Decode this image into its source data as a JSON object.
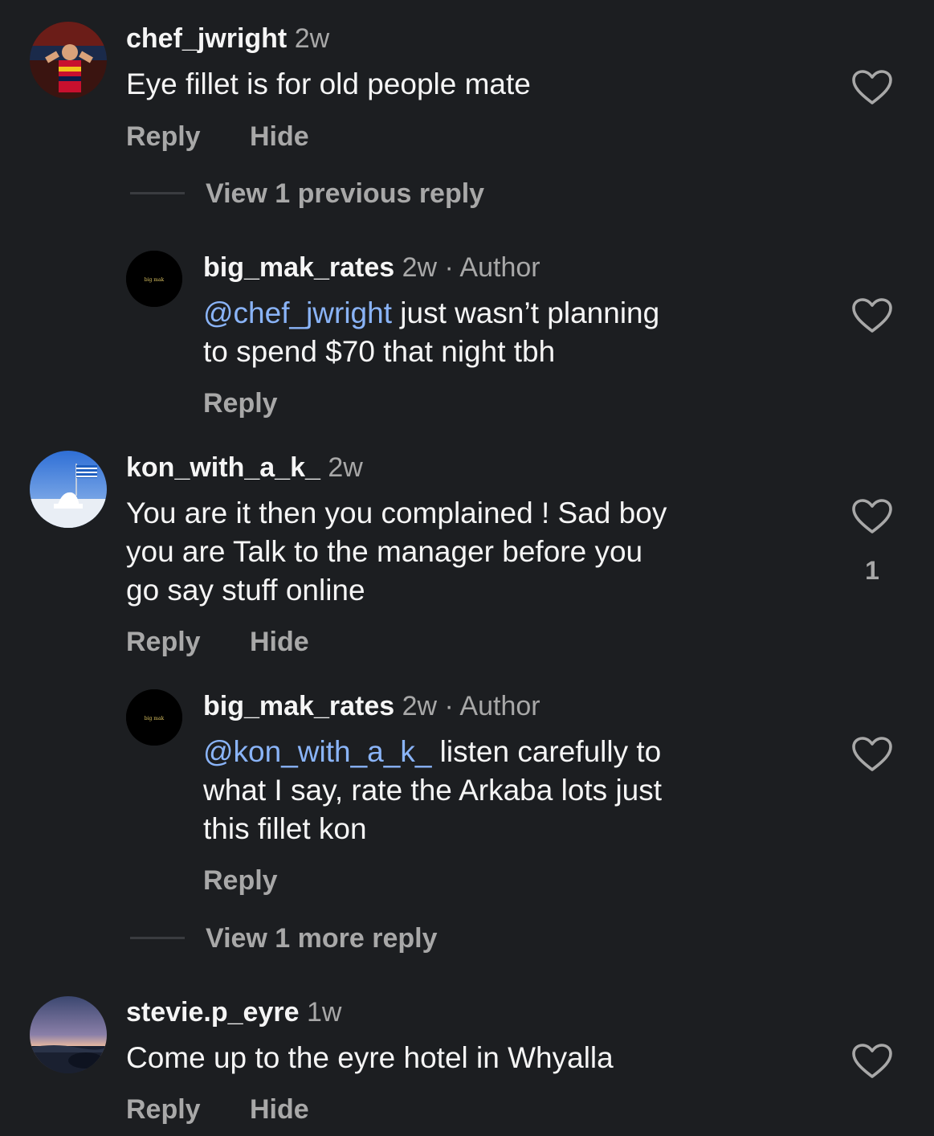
{
  "comments": [
    {
      "username": "chef_jwright",
      "time": "2w",
      "text": "Eye fillet is for old people mate",
      "reply_label": "Reply",
      "hide_label": "Hide"
    },
    {
      "username": "kon_with_a_k_",
      "time": "2w",
      "text_lines": [
        "You are it then you complained ! Sad boy",
        "you are Talk to the manager before you",
        "go say stuff online"
      ],
      "like_count": "1",
      "reply_label": "Reply",
      "hide_label": "Hide"
    },
    {
      "username": "stevie.p_eyre",
      "time": "1w",
      "text": "Come up to the eyre hotel in Whyalla",
      "reply_label": "Reply",
      "hide_label": "Hide"
    }
  ],
  "replies": [
    {
      "username": "big_mak_rates",
      "time": "2w",
      "separator": "·",
      "badge": "Author",
      "mention": "@chef_jwright",
      "line1_rest": " just wasn’t planning",
      "line2": "to spend $70 that night tbh",
      "reply_label": "Reply",
      "avatar_text": "big mak"
    },
    {
      "username": "big_mak_rates",
      "time": "2w",
      "separator": "·",
      "badge": "Author",
      "mention": "@kon_with_a_k_",
      "line1_rest": " listen carefully to",
      "line2": "what I say, rate the Arkaba lots just",
      "line3": "this fillet kon",
      "reply_label": "Reply",
      "avatar_text": "big mak"
    }
  ],
  "view_previous": "View 1 previous reply",
  "view_more": "View 1 more reply",
  "colors": {
    "background": "#1c1e21",
    "text": "#f5f5f5",
    "muted": "#a8a8a8",
    "mention": "#8ab4f8"
  }
}
